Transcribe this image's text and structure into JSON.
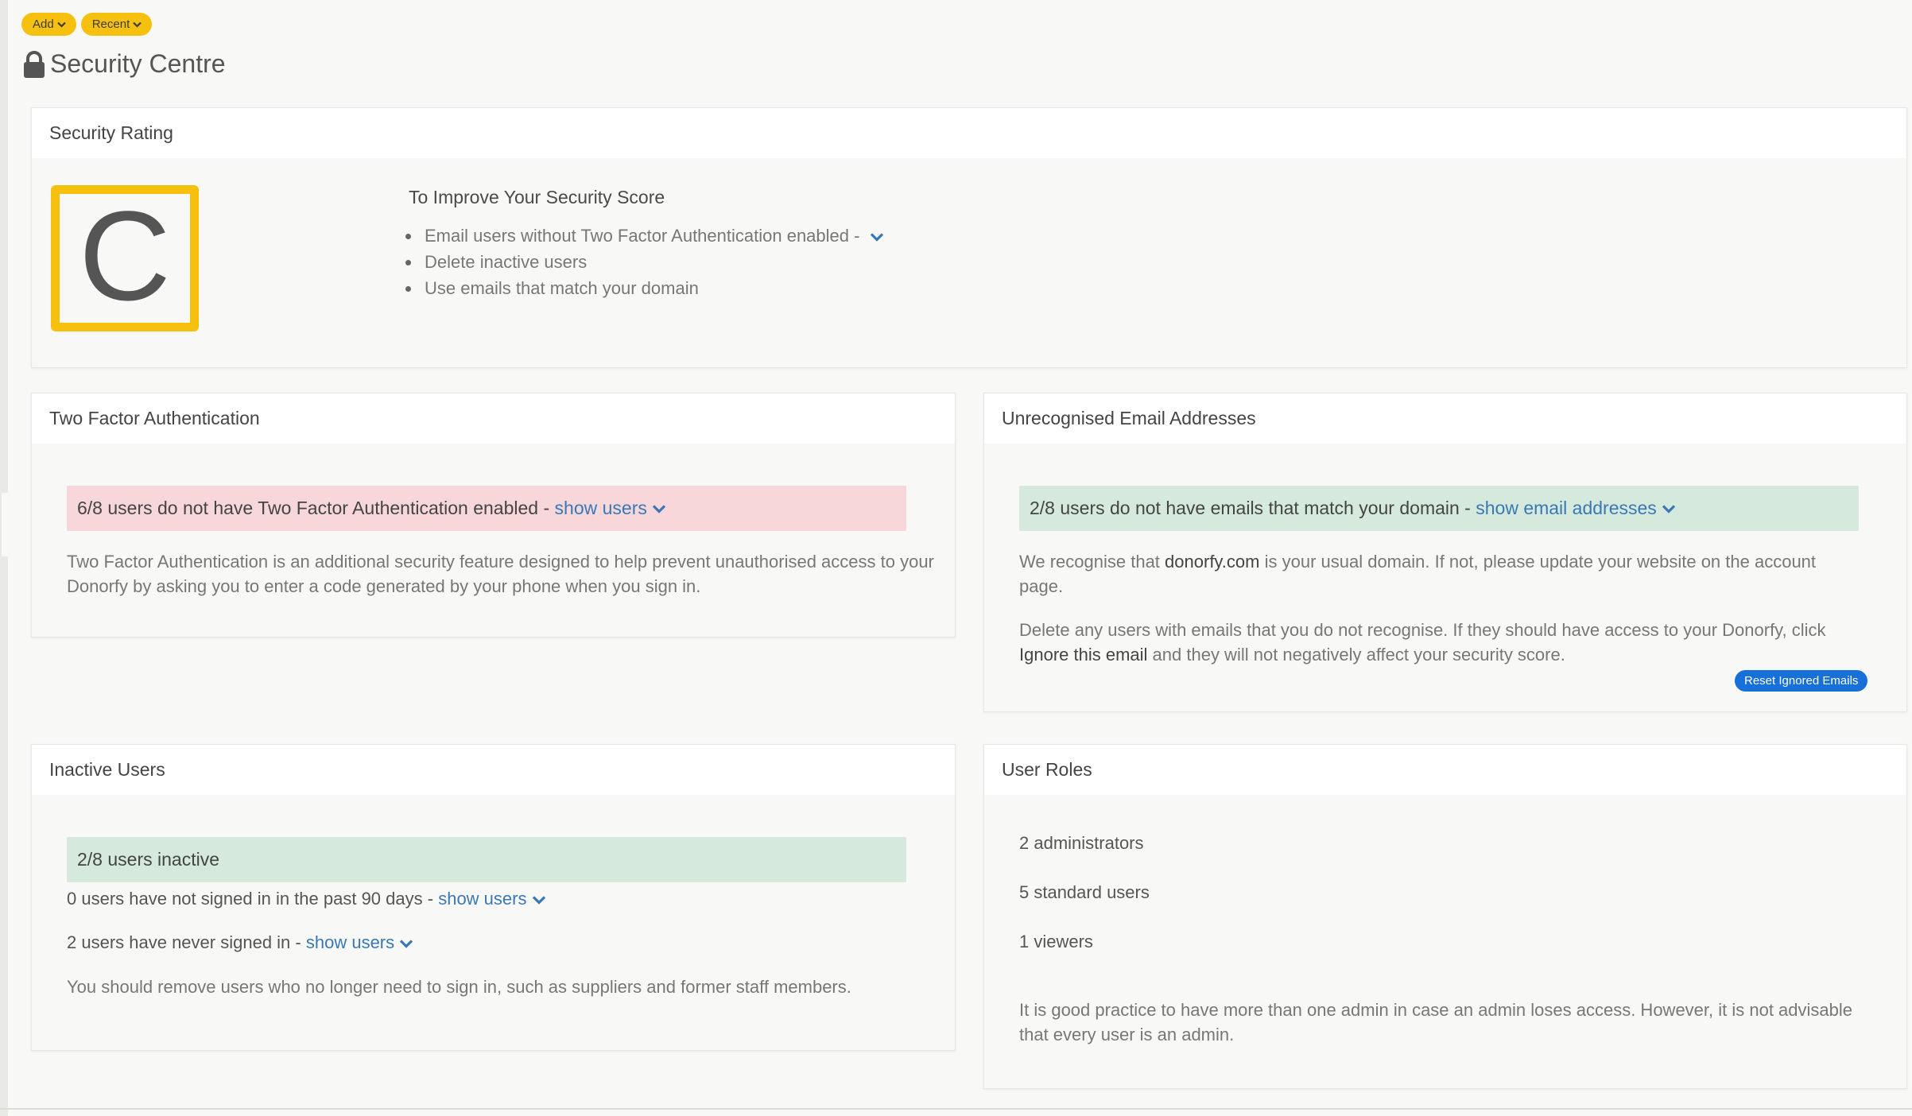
{
  "toolbar": {
    "add_label": "Add",
    "recent_label": "Recent"
  },
  "page": {
    "title": "Security Centre"
  },
  "security_rating": {
    "header": "Security Rating",
    "grade": "C",
    "improve_title": "To Improve Your Security Score",
    "items": [
      "Email users without Two Factor Authentication enabled -",
      "Delete inactive users",
      "Use emails that match your domain"
    ]
  },
  "two_factor": {
    "header": "Two Factor Authentication",
    "alert_text": "6/8 users do not have Two Factor Authentication enabled -",
    "alert_link": "show users",
    "description": "Two Factor Authentication is an additional security feature designed to help prevent unauthorised access to your Donorfy by asking you to enter a code generated by your phone when you sign in."
  },
  "unrecognised": {
    "header": "Unrecognised Email Addresses",
    "alert_text": "2/8 users do not have emails that match your domain -",
    "alert_link": "show email addresses",
    "para1_prefix": "We recognise that",
    "domain": "donorfy.com",
    "para1_suffix": "is your usual domain. If not, please update your website on the account page.",
    "para2_prefix": "Delete any users with emails that you do not recognise. If they should have access to your Donorfy, click",
    "ignore_label": "Ignore this email",
    "para2_suffix": "and they will not negatively affect your security score.",
    "reset_button": "Reset Ignored Emails"
  },
  "inactive": {
    "header": "Inactive Users",
    "alert_text": "2/8 users inactive",
    "line1_text": "0 users have not signed in in the past 90 days -",
    "line1_link": "show users",
    "line2_text": "2 users have never signed in -",
    "line2_link": "show users",
    "description": "You should remove users who no longer need to sign in, such as suppliers and former staff members."
  },
  "roles": {
    "header": "User Roles",
    "administrators": "2 administrators",
    "standard": "5 standard users",
    "viewers": "1 viewers",
    "description": "It is good practice to have more than one admin in case an admin loses access. However, it is not advisable that every user is an admin."
  },
  "icons": {
    "lock": "lock-icon",
    "chevron": "chevron-down-icon"
  },
  "colors": {
    "accent_yellow": "#f5c00e",
    "link_blue": "#3a78b5",
    "alert_red_bg": "#f7d7da",
    "alert_green_bg": "#d5eadc",
    "button_blue": "#1770d9"
  }
}
